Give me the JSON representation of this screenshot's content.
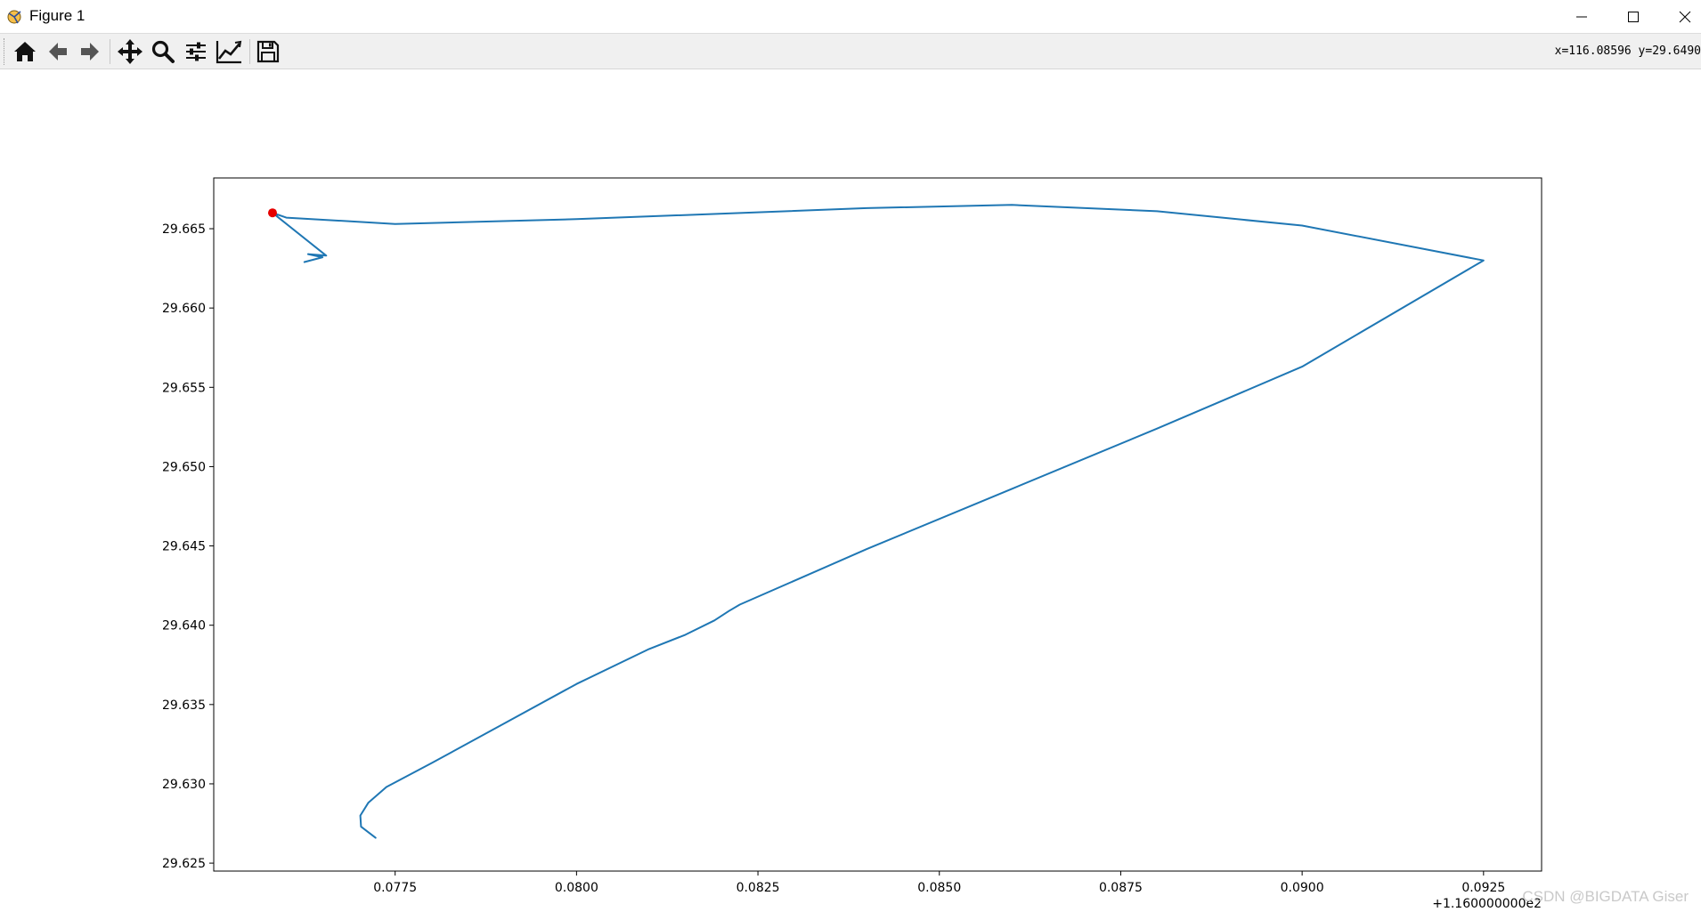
{
  "window": {
    "title": "Figure 1",
    "controls": [
      "minimize",
      "maximize",
      "close"
    ]
  },
  "toolbar": {
    "buttons": [
      {
        "name": "home",
        "icon": "home-icon"
      },
      {
        "name": "back",
        "icon": "arrow-left-icon"
      },
      {
        "name": "forward",
        "icon": "arrow-right-icon"
      },
      {
        "name": "pan",
        "icon": "move-icon"
      },
      {
        "name": "zoom",
        "icon": "magnifier-icon"
      },
      {
        "name": "subplots",
        "icon": "sliders-icon"
      },
      {
        "name": "edit-axis",
        "icon": "line-chart-icon"
      },
      {
        "name": "save",
        "icon": "floppy-disk-icon"
      }
    ],
    "coordinates": "x=116.08596 y=29.6490"
  },
  "watermark": "CSDN @BIGDATA Giser",
  "chart_data": {
    "type": "line",
    "title": "",
    "xlabel": "",
    "ylabel": "",
    "x_offset_label": "+1.160000000e2",
    "xlim": [
      116.075,
      116.0933
    ],
    "ylim": [
      29.6245,
      29.6682
    ],
    "xticks": [
      116.0775,
      116.08,
      116.0825,
      116.085,
      116.0875,
      116.09,
      116.0925
    ],
    "xtick_labels": [
      "0.0775",
      "0.0800",
      "0.0825",
      "0.0850",
      "0.0875",
      "0.0900",
      "0.0925"
    ],
    "yticks": [
      29.625,
      29.63,
      29.635,
      29.64,
      29.645,
      29.65,
      29.655,
      29.66,
      29.665
    ],
    "ytick_labels": [
      "29.625",
      "29.630",
      "29.635",
      "29.640",
      "29.645",
      "29.650",
      "29.655",
      "29.660",
      "29.665"
    ],
    "grid": false,
    "series": [
      {
        "color": "#1f77b4",
        "x": [
          116.07723,
          116.07703,
          116.07702,
          116.07713,
          116.07738,
          116.078,
          116.079,
          116.08,
          116.081,
          116.0815,
          116.0819,
          116.0821,
          116.08225,
          116.084,
          116.086,
          116.088,
          116.09,
          116.0925,
          116.09,
          116.088,
          116.086,
          116.084,
          116.08,
          116.0775,
          116.076,
          116.07581,
          116.07655,
          116.0763,
          116.0765,
          116.07625
        ],
        "y": [
          29.6266,
          29.6273,
          29.628,
          29.6288,
          29.6298,
          29.6313,
          29.6338,
          29.6363,
          29.6385,
          29.6394,
          29.6403,
          29.6409,
          29.6413,
          29.6448,
          29.6486,
          29.6524,
          29.6563,
          29.663,
          29.6652,
          29.6661,
          29.6665,
          29.6663,
          29.6656,
          29.6653,
          29.6657,
          29.666,
          29.6633,
          29.6634,
          29.6632,
          29.6629
        ]
      }
    ],
    "markers": [
      {
        "x": 116.07581,
        "y": 29.666,
        "color": "#e60000"
      }
    ]
  }
}
